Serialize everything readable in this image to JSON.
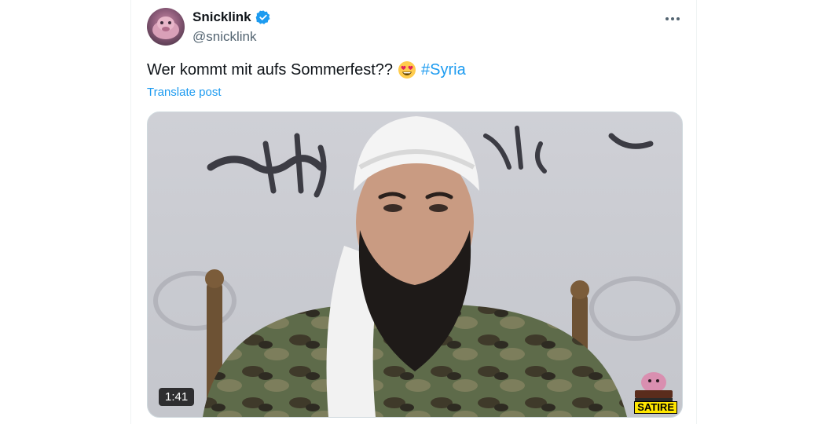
{
  "post": {
    "author_name": "Snicklink",
    "author_handle": "@snicklink",
    "text": "Wer kommt mit aufs Sommerfest??",
    "emoji_icon": "heart-eyes-emoji",
    "hashtag": "#Syria",
    "translate_label": "Translate post",
    "video_duration": "1:41",
    "watermark_label": "SATIRE",
    "accent_color": "#1d9bf0"
  }
}
